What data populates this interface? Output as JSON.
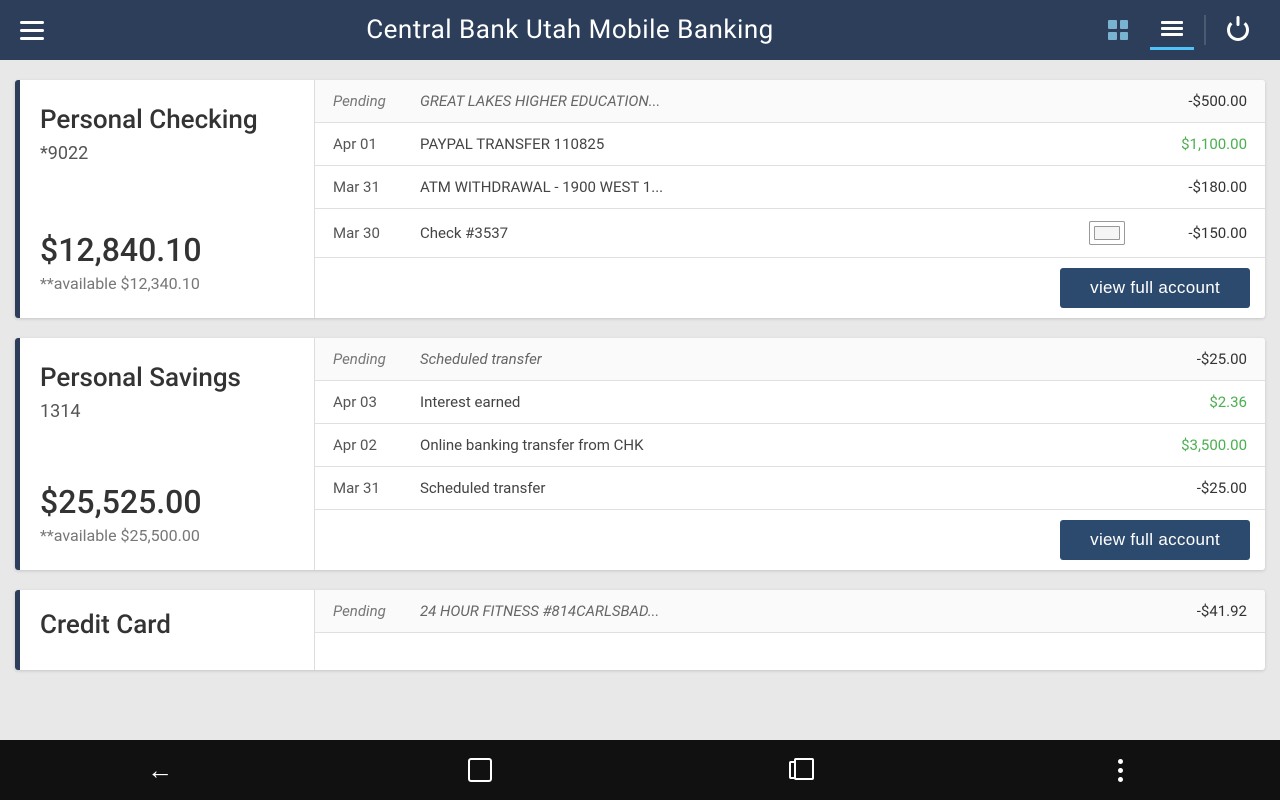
{
  "header": {
    "title": "Central Bank Utah Mobile Banking",
    "menu_label": "Menu",
    "grid_icon_label": "Grid View",
    "list_icon_label": "List View",
    "power_icon_label": "Power"
  },
  "accounts": [
    {
      "id": "personal-checking",
      "name": "Personal Checking",
      "number": "*9022",
      "balance": "$12,840.10",
      "available": "**available $12,340.10",
      "transactions": [
        {
          "date": "Pending",
          "desc": "GREAT LAKES HIGHER EDUCATION...",
          "amount": "-$500.00",
          "positive": false,
          "pending": true,
          "has_check": false
        },
        {
          "date": "Apr 01",
          "desc": "PAYPAL TRANSFER 110825",
          "amount": "$1,100.00",
          "positive": true,
          "pending": false,
          "has_check": false
        },
        {
          "date": "Mar 31",
          "desc": "ATM WITHDRAWAL - 1900 WEST 1...",
          "amount": "-$180.00",
          "positive": false,
          "pending": false,
          "has_check": false
        },
        {
          "date": "Mar 30",
          "desc": "Check #3537",
          "amount": "-$150.00",
          "positive": false,
          "pending": false,
          "has_check": true
        }
      ],
      "view_full_account_label": "view full account"
    },
    {
      "id": "personal-savings",
      "name": "Personal Savings",
      "number": "1314",
      "balance": "$25,525.00",
      "available": "**available $25,500.00",
      "transactions": [
        {
          "date": "Pending",
          "desc": "Scheduled transfer",
          "amount": "-$25.00",
          "positive": false,
          "pending": true,
          "has_check": false
        },
        {
          "date": "Apr 03",
          "desc": "Interest earned",
          "amount": "$2.36",
          "positive": true,
          "pending": false,
          "has_check": false
        },
        {
          "date": "Apr 02",
          "desc": "Online banking transfer from CHK",
          "amount": "$3,500.00",
          "positive": true,
          "pending": false,
          "has_check": false
        },
        {
          "date": "Mar 31",
          "desc": "Scheduled transfer",
          "amount": "-$25.00",
          "positive": false,
          "pending": false,
          "has_check": false
        }
      ],
      "view_full_account_label": "view full account"
    }
  ],
  "credit_card": {
    "name": "Credit Card",
    "transactions": [
      {
        "date": "Pending",
        "desc": "24 HOUR FITNESS #814CARLSBAD...",
        "amount": "-$41.92",
        "positive": false,
        "pending": true,
        "has_check": false
      }
    ]
  },
  "bottom_nav": {
    "back_label": "Back",
    "home_label": "Home",
    "recents_label": "Recents",
    "more_label": "More"
  }
}
